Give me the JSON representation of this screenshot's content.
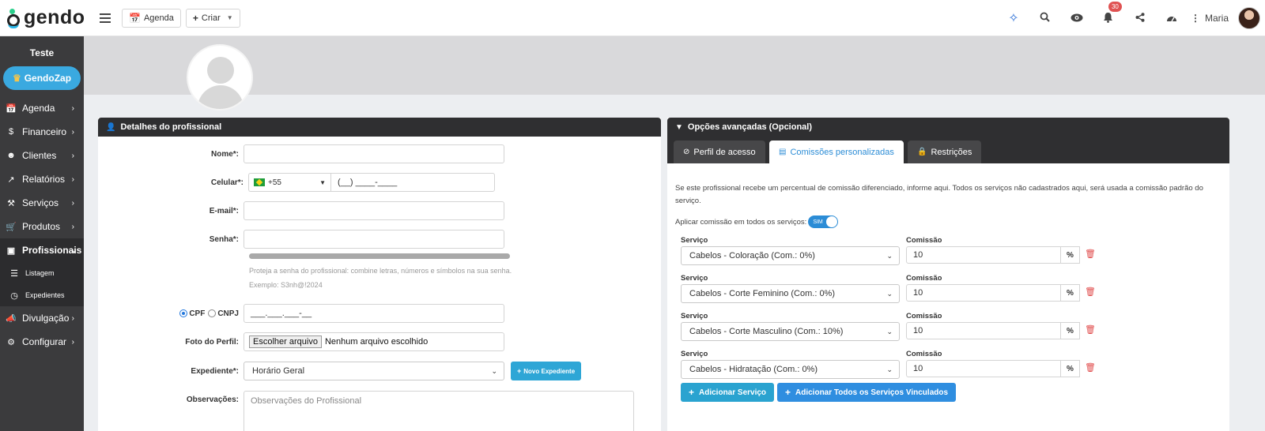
{
  "brand": {
    "logo_text": "gendo"
  },
  "topbar": {
    "agenda_label": "Agenda",
    "criar_label": "Criar",
    "notification_count": "30",
    "user_name": "Maria"
  },
  "sidebar": {
    "title": "Teste",
    "zap_label": "GendoZap",
    "items": [
      {
        "label": "Agenda",
        "icon": "calendar-icon"
      },
      {
        "label": "Financeiro",
        "icon": "dollar-icon"
      },
      {
        "label": "Clientes",
        "icon": "users-icon"
      },
      {
        "label": "Relatórios",
        "icon": "chart-icon"
      },
      {
        "label": "Serviços",
        "icon": "wrench-icon"
      },
      {
        "label": "Produtos",
        "icon": "cart-icon"
      },
      {
        "label": "Profissionais",
        "icon": "id-card-icon"
      }
    ],
    "sub_items": [
      {
        "label": "Listagem",
        "icon": "list-icon"
      },
      {
        "label": "Expedientes",
        "icon": "clock-icon"
      }
    ],
    "bottom_items": [
      {
        "label": "Divulgação",
        "icon": "megaphone-icon"
      },
      {
        "label": "Configurar",
        "icon": "gear-icon"
      }
    ]
  },
  "details": {
    "title": "Detalhes do profissional",
    "name_label": "Nome*:",
    "phone_label": "Celular*:",
    "phone_code": "+55",
    "phone_placeholder": "(__) ____-____",
    "email_label": "E-mail*:",
    "password_label": "Senha*:",
    "password_hint": "Proteja a senha do profissional: combine letras, números e símbolos na sua senha. Exemplo: S3nh@!2024",
    "cpf_label": "CPF",
    "cnpj_label": "CNPJ",
    "cpf_placeholder": "___.___.___-__",
    "photo_label": "Foto do Perfil:",
    "file_button": "Escolher arquivo",
    "file_status": "Nenhum arquivo escolhido",
    "schedule_label": "Expediente*:",
    "schedule_value": "Horário Geral",
    "new_schedule_button": "Novo Expediente",
    "notes_label": "Observações:",
    "notes_placeholder": "Observações do Profissional"
  },
  "advanced": {
    "title": "Opções avançadas (Opcional)",
    "tabs": [
      {
        "label": "Perfil  de acesso",
        "icon": "ban-icon"
      },
      {
        "label": "Comissões  personalizadas",
        "icon": "money-icon"
      },
      {
        "label": "Restrições",
        "icon": "lock-icon"
      }
    ],
    "description": "Se este profissional recebe um percentual de comissão diferenciado, informe aqui. Todos os serviços não cadastrados aqui, será usada a comissão padrão do serviço.",
    "apply_all_label": "Aplicar comissão em todos os serviços:",
    "toggle_label": "SIM",
    "service_col": "Serviço",
    "commission_col": "Comissão",
    "percent_symbol": "%",
    "rows": [
      {
        "service": "Cabelos - Coloração (Com.: 0%)",
        "commission": "10"
      },
      {
        "service": "Cabelos - Corte Feminino (Com.: 0%)",
        "commission": "10"
      },
      {
        "service": "Cabelos - Corte Masculino (Com.: 10%)",
        "commission": "10"
      },
      {
        "service": "Cabelos - Hidratação (Com.: 0%)",
        "commission": "10"
      }
    ],
    "add_service_button": "Adicionar Serviço",
    "add_all_button": "Adicionar Todos os Serviços Vinculados"
  },
  "colors": {
    "accent": "#2ea6d6",
    "primary": "#2b8cd6",
    "sidebar": "#3b3b3d",
    "danger": "#e04a4a"
  }
}
